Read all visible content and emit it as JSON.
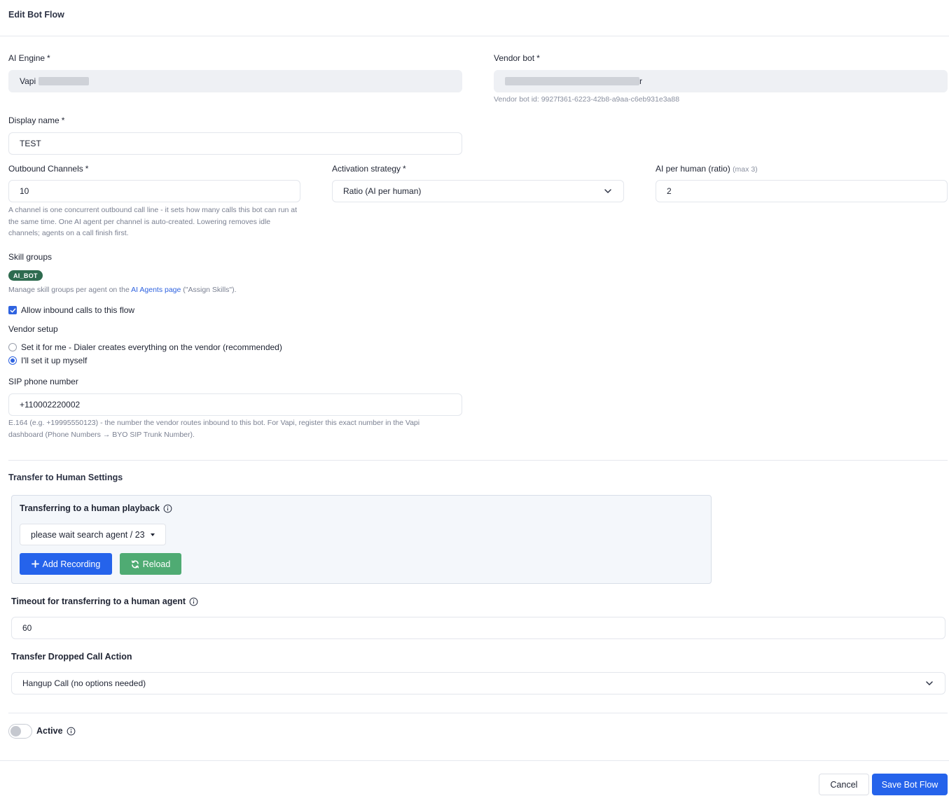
{
  "modal": {
    "title": "Edit Bot Flow"
  },
  "ai_engine": {
    "label": "AI Engine",
    "required": "*",
    "value": "Vapi"
  },
  "vendor_bot": {
    "label": "Vendor bot",
    "required": "*",
    "value_suffix": "r",
    "id_text": "Vendor bot id: 9927f361-6223-42b8-a9aa-c6eb931e3a88"
  },
  "display_name": {
    "label": "Display name",
    "required": "*",
    "value": "TEST"
  },
  "outbound_channels": {
    "label": "Outbound Channels",
    "required": "*",
    "value": "10",
    "help": "A channel is one concurrent outbound call line - it sets how many calls this bot can run at the same time. One AI agent per channel is auto-created. Lowering removes idle channels; agents on a call finish first."
  },
  "activation_strategy": {
    "label": "Activation strategy",
    "required": "*",
    "value": "Ratio (AI per human)"
  },
  "ai_per_human": {
    "label": "AI per human (ratio)",
    "hint": "(max 3)",
    "value": "2"
  },
  "skill_groups": {
    "label": "Skill groups",
    "badge": "AI_BOT",
    "help_prefix": "Manage skill groups per agent on the ",
    "help_link": "AI Agents page",
    "help_suffix": " (\"Assign Skills\")."
  },
  "allow_inbound": {
    "label": "Allow inbound calls to this flow",
    "checked": true
  },
  "vendor_setup": {
    "label": "Vendor setup",
    "options": [
      {
        "label": "Set it for me - Dialer creates everything on the vendor (recommended)",
        "selected": false
      },
      {
        "label": "I'll set it up myself",
        "selected": true
      }
    ]
  },
  "sip_phone": {
    "label": "SIP phone number",
    "value": "+110002220002",
    "help_line1": "E.164 (e.g. +19995550123) - the number the vendor routes inbound to this bot. For Vapi, register this exact number in the Vapi",
    "help_line2": "dashboard (Phone Numbers → BYO SIP Trunk Number)."
  },
  "transfer": {
    "section_title": "Transfer to Human Settings",
    "playback_title": "Transferring to a human playback",
    "playback_value": "please wait search agent / 23",
    "add_recording": "Add Recording",
    "reload": "Reload",
    "timeout_label": "Timeout for transferring to a human agent",
    "timeout_value": "60",
    "dropped_label": "Transfer Dropped Call Action",
    "dropped_value": "Hangup Call (no options needed)"
  },
  "active": {
    "label": "Active",
    "on": false
  },
  "footer": {
    "cancel": "Cancel",
    "save": "Save Bot Flow"
  },
  "colors": {
    "primary": "#2563eb",
    "success": "#4fab73",
    "badge": "#2e6b4f",
    "link": "#2f63e0"
  }
}
